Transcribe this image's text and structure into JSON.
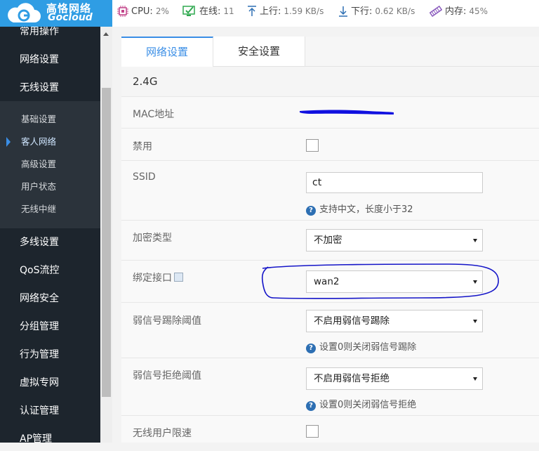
{
  "brand": {
    "name_cn": "高恪网络",
    "name_en": "Gocloud",
    "color": "#2f9de4"
  },
  "status": {
    "cpu": {
      "label": "CPU:",
      "value": "2%"
    },
    "online": {
      "label": "在线:",
      "value": "11"
    },
    "upload": {
      "label": "上行:",
      "value": "1.59 KB/s"
    },
    "download": {
      "label": "下行:",
      "value": "0.62 KB/s"
    },
    "memory": {
      "label": "内存:",
      "value": "45%"
    }
  },
  "sidebar": {
    "items": [
      {
        "label": "常用操作"
      },
      {
        "label": "网络设置"
      },
      {
        "label": "无线设置"
      },
      {
        "label": "多线设置"
      },
      {
        "label": "QoS流控"
      },
      {
        "label": "网络安全"
      },
      {
        "label": "分组管理"
      },
      {
        "label": "行为管理"
      },
      {
        "label": "虚拟专网"
      },
      {
        "label": "认证管理"
      },
      {
        "label": "AP管理"
      }
    ],
    "submenu": [
      {
        "label": "基础设置"
      },
      {
        "label": "客人网络",
        "active": true
      },
      {
        "label": "高级设置"
      },
      {
        "label": "用户状态"
      },
      {
        "label": "无线中继"
      }
    ]
  },
  "tabs": [
    {
      "label": "网络设置",
      "active": true
    },
    {
      "label": "安全设置"
    }
  ],
  "form": {
    "section_title": "2.4G",
    "mac": {
      "label": "MAC地址"
    },
    "disable": {
      "label": "禁用",
      "checked": false
    },
    "ssid": {
      "label": "SSID",
      "value": "ct",
      "hint": "支持中文，长度小于32"
    },
    "encryption": {
      "label": "加密类型",
      "value": "不加密"
    },
    "bind_interface": {
      "label": "绑定接口",
      "value": "wan2"
    },
    "weak_kick": {
      "label": "弱信号踢除阈值",
      "value": "不启用弱信号踢除",
      "hint": "设置0则关闭弱信号踢除"
    },
    "weak_reject": {
      "label": "弱信号拒绝阈值",
      "value": "不启用弱信号拒绝",
      "hint": "设置0则关闭弱信号拒绝"
    },
    "rate_limit": {
      "label": "无线用户限速",
      "checked": false
    }
  },
  "hint_icon": "?",
  "colors": {
    "accent": "#3a8ee6",
    "sidebar_bg": "#1d252d",
    "annotation": "#1515c8",
    "redaction": "#1010e0"
  }
}
